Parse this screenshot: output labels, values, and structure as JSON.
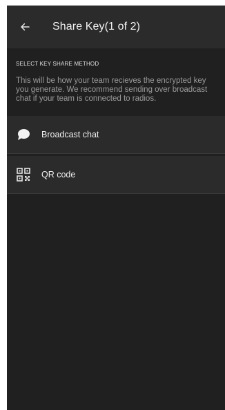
{
  "app_bar": {
    "title": "Share Key(1 of 2)",
    "back_icon": "arrow-left-icon"
  },
  "section": {
    "header": "SELECT KEY SHARE METHOD",
    "description": "This will be how your team recieves the encrypted key you generate. We recommend sending over broadcast chat if your team is connected to radios."
  },
  "options": [
    {
      "label": "Broadcast chat",
      "icon": "chat-bubble-icon"
    },
    {
      "label": "QR code",
      "icon": "qr-code-icon"
    }
  ],
  "colors": {
    "background": "#202020",
    "surface": "#2b2b2b",
    "text_primary": "#f0f0f0",
    "text_secondary": "#9a9a9a"
  }
}
